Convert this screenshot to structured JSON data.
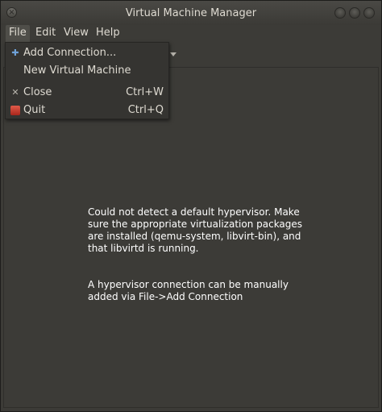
{
  "window": {
    "title": "Virtual Machine Manager"
  },
  "menubar": {
    "items": [
      {
        "label": "File"
      },
      {
        "label": "Edit"
      },
      {
        "label": "View"
      },
      {
        "label": "Help"
      }
    ]
  },
  "file_menu": {
    "items": [
      {
        "label": "Add Connection...",
        "accel": "",
        "icon": "add-connection-icon"
      },
      {
        "label": "New Virtual Machine",
        "accel": "",
        "icon": ""
      },
      {
        "label": "Close",
        "accel": "Ctrl+W",
        "icon": "close-icon"
      },
      {
        "label": "Quit",
        "accel": "Ctrl+Q",
        "icon": "quit-icon"
      }
    ]
  },
  "message": {
    "line1": "Could not detect a default hypervisor. Make sure the appropriate virtualization packages are installed (qemu-system, libvirt-bin), and that libvirtd is running.",
    "line2": "A hypervisor connection can be manually added via File->Add Connection"
  },
  "colors": {
    "background": "#3c3b37",
    "menu_active": "#4f4e49",
    "text": "#dfdbd2"
  }
}
